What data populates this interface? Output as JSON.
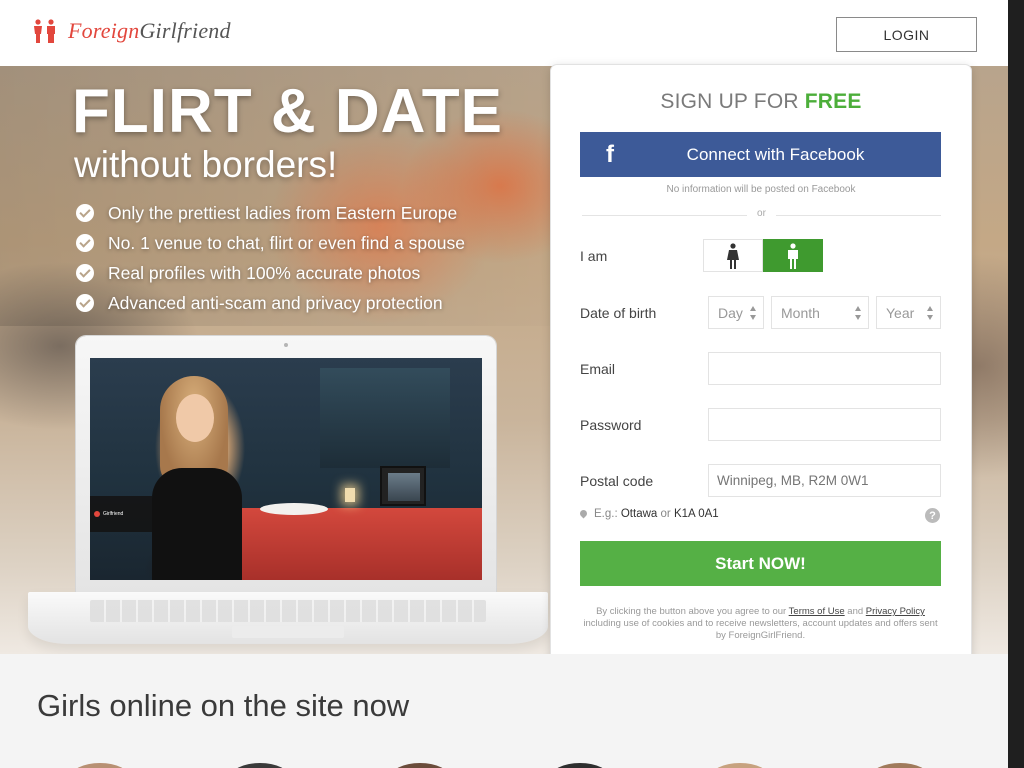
{
  "header": {
    "logo_part1": "Foreign",
    "logo_part2": "Girlfriend",
    "login_label": "LOGIN"
  },
  "hero": {
    "headline": "FLIRT & DATE",
    "subheadline": "without borders!",
    "features": [
      "Only the prettiest ladies from Eastern Europe",
      "No. 1 venue to chat, flirt or even find a spouse",
      "Real profiles with 100% accurate photos",
      "Advanced anti-scam and privacy protection"
    ]
  },
  "signup": {
    "title_prefix": "SIGN UP FOR",
    "title_accent": "FREE",
    "facebook_label": "Connect with Facebook",
    "facebook_note": "No information will be posted on Facebook",
    "or_label": "or",
    "i_am_label": "I am",
    "dob_label": "Date of birth",
    "dob_day": "Day",
    "dob_month": "Month",
    "dob_year": "Year",
    "email_label": "Email",
    "email_value": "",
    "password_label": "Password",
    "password_value": "",
    "postal_label": "Postal code",
    "postal_placeholder": "Winnipeg, MB, R2M 0W1",
    "eg_prefix": "E.g.:",
    "eg_city": "Ottawa",
    "eg_or": "or",
    "eg_code": "K1A 0A1",
    "help_icon": "?",
    "start_label": "Start NOW!",
    "terms_1": "By clicking the button above you agree to our",
    "terms_link": "Terms of Use",
    "terms_and": "and",
    "privacy_link": "Privacy Policy",
    "terms_2": "including use of cookies and to receive newsletters, account updates and offers sent by ForeignGirlFriend."
  },
  "bottom": {
    "title": "Girls online on the site now"
  },
  "colors": {
    "brand": "#e2473d",
    "accent_green": "#55b045",
    "facebook": "#3d5a98"
  }
}
